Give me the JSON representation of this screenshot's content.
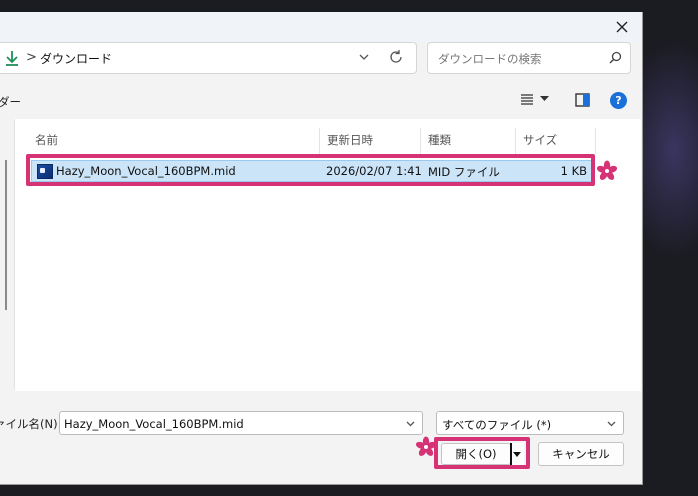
{
  "address_bar": {
    "breadcrumb_separator": ">",
    "breadcrumb": "ダウンロード"
  },
  "search": {
    "placeholder": "ダウンロードの検索"
  },
  "toolbar": {
    "left_label": "ダー"
  },
  "columns": [
    {
      "label": "名前"
    },
    {
      "label": "更新日時"
    },
    {
      "label": "種類"
    },
    {
      "label": "サイズ"
    }
  ],
  "files": [
    {
      "name": "Hazy_Moon_Vocal_160BPM.mid",
      "modified": "2026/02/07 1:41",
      "type": "MID ファイル",
      "size": "1 KB",
      "selected": true
    }
  ],
  "bottom": {
    "filename_label": "ァイル名(N):",
    "filename_value": "Hazy_Moon_Vocal_160BPM.mid",
    "filetype_value": "すべてのファイル (*)",
    "open_label": "開く(O)",
    "cancel_label": "キャンセル"
  },
  "colors": {
    "highlight_border": "#d63377",
    "selection_fill": "#cce4f7",
    "help_icon": "#1a6fd8"
  },
  "icons": [
    "close-icon",
    "download-arrow-icon",
    "chevron-down-icon",
    "refresh-icon",
    "search-icon",
    "view-list-icon",
    "preview-pane-icon",
    "help-icon",
    "midi-file-icon",
    "sakura-icon"
  ]
}
